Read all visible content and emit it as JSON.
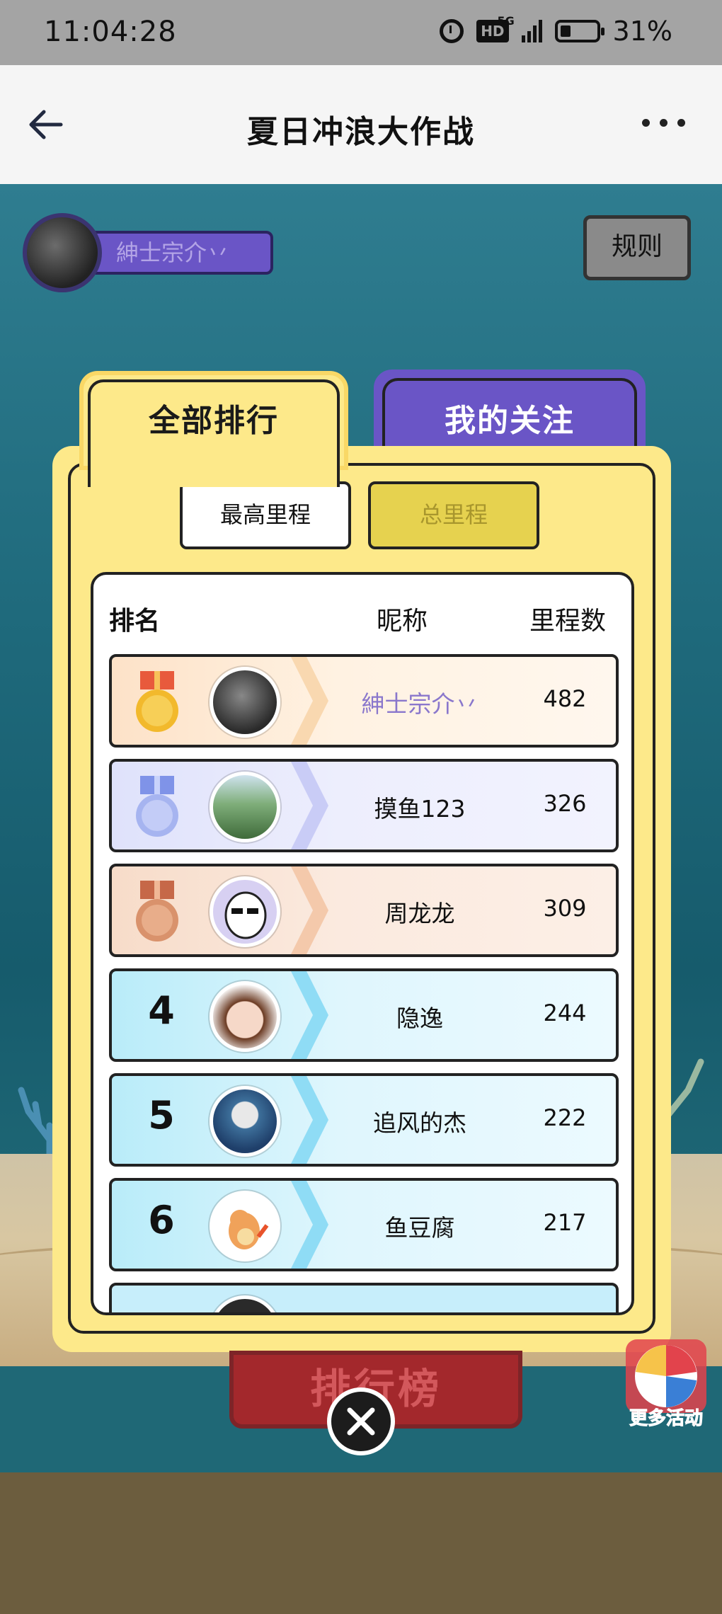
{
  "status_bar": {
    "time": "11:04:28",
    "network": "5G",
    "hd_badge": "HD",
    "battery": "31%"
  },
  "nav": {
    "title": "夏日冲浪大作战"
  },
  "player": {
    "name": "紳士宗介丷"
  },
  "rules_label": "规则",
  "tabs": {
    "all_ranking": "全部排行",
    "my_follow": "我的关注"
  },
  "segments": {
    "max_distance": "最高里程",
    "total_distance": "总里程"
  },
  "board": {
    "headers": {
      "rank": "排名",
      "nickname": "昵称",
      "distance": "里程数"
    },
    "rows": [
      {
        "rank": "1",
        "name": "紳士宗介丷",
        "score": "482"
      },
      {
        "rank": "2",
        "name": "摸鱼123",
        "score": "326"
      },
      {
        "rank": "3",
        "name": "周龙龙",
        "score": "309"
      },
      {
        "rank": "4",
        "name": "隐逸",
        "score": "244"
      },
      {
        "rank": "5",
        "name": "追风的杰",
        "score": "222"
      },
      {
        "rank": "6",
        "name": "鱼豆腐",
        "score": "217"
      }
    ]
  },
  "leaderboard_banner": "排行榜",
  "more_events": "更多活动",
  "colors": {
    "panel_yellow": "#fde98a",
    "purple": "#6a55c6",
    "gold": "#f2b92c",
    "silver": "#a6b4f0",
    "bronze": "#d9926c"
  }
}
